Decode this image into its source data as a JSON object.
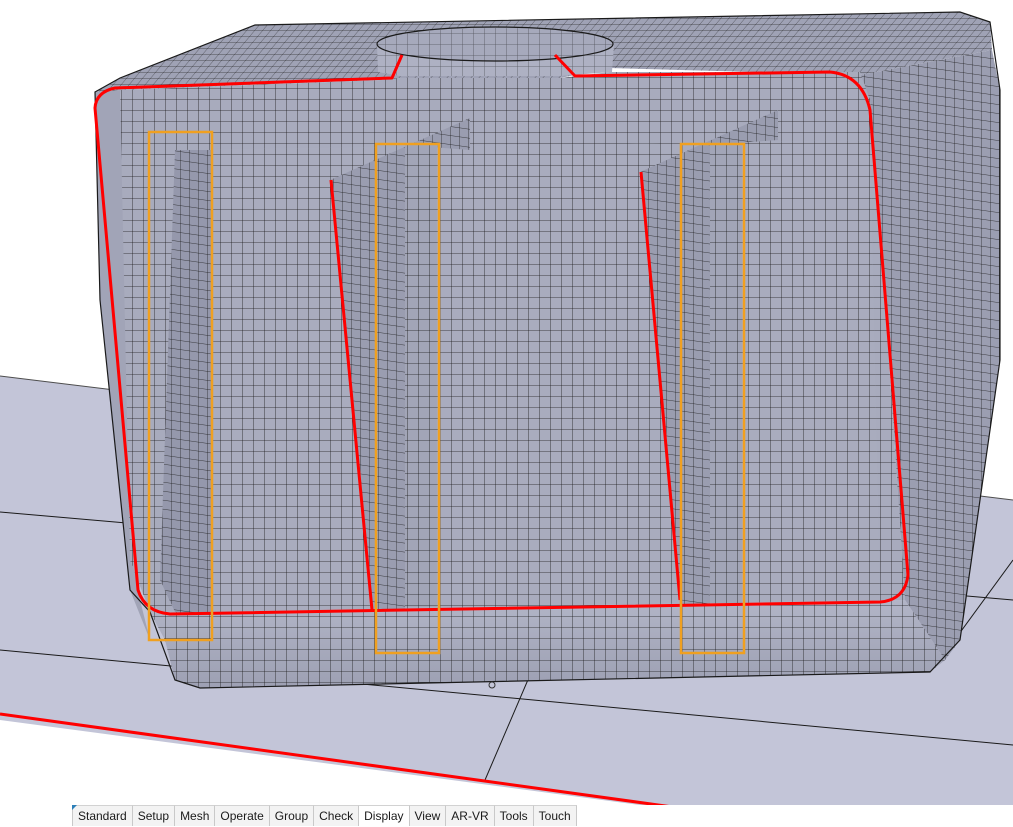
{
  "tabs": [
    {
      "label": "Standard",
      "active": false
    },
    {
      "label": "Setup",
      "active": false
    },
    {
      "label": "Mesh",
      "active": false
    },
    {
      "label": "Operate",
      "active": false
    },
    {
      "label": "Group",
      "active": false
    },
    {
      "label": "Check",
      "active": false
    },
    {
      "label": "Display",
      "active": true
    },
    {
      "label": "View",
      "active": false
    },
    {
      "label": "AR-VR",
      "active": false
    },
    {
      "label": "Tools",
      "active": false
    },
    {
      "label": "Touch",
      "active": false
    }
  ],
  "colors": {
    "mesh_surface": "#a4a7ba",
    "mesh_dark": "#8c8fa3",
    "mesh_light": "#b6b9ca",
    "mesh_line": "#1a1a1a",
    "ground": "#c3c5d8",
    "outline_highlight": "#ff0000",
    "selection_box": "#f0a020"
  }
}
